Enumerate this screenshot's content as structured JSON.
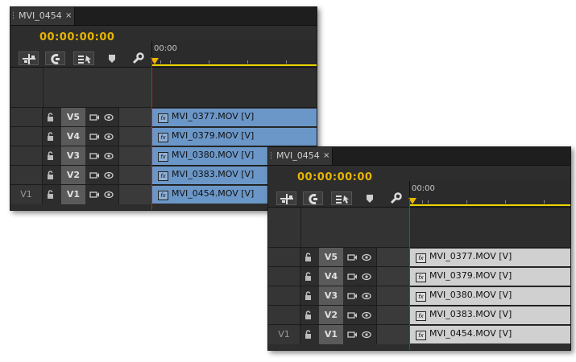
{
  "panels": [
    {
      "id": "a",
      "tab_title": "MVI_0454",
      "tab_close": "×",
      "timecode": "00:00:00:00",
      "ruler_start": "00:00",
      "clip_color": "#6b97c8",
      "source_patch": "V1",
      "tracks": [
        {
          "name": "V5",
          "clip": "MVI_0377.MOV [V]"
        },
        {
          "name": "V4",
          "clip": "MVI_0379.MOV [V]"
        },
        {
          "name": "V3",
          "clip": "MVI_0380.MOV [V]"
        },
        {
          "name": "V2",
          "clip": "MVI_0383.MOV [V]"
        },
        {
          "name": "V1",
          "clip": "MVI_0454.MOV [V]"
        }
      ]
    },
    {
      "id": "b",
      "tab_title": "MVI_0454",
      "tab_close": "×",
      "timecode": "00:00:00:00",
      "ruler_start": "00:00",
      "clip_color": "#d0d0d0",
      "source_patch": "V1",
      "tracks": [
        {
          "name": "V5",
          "clip": "MVI_0377.MOV [V]"
        },
        {
          "name": "V4",
          "clip": "MVI_0379.MOV [V]"
        },
        {
          "name": "V3",
          "clip": "MVI_0380.MOV [V]"
        },
        {
          "name": "V2",
          "clip": "MVI_0383.MOV [V]"
        },
        {
          "name": "V1",
          "clip": "MVI_0454.MOV [V]"
        }
      ]
    }
  ],
  "icons": {
    "fx_badge": "fx",
    "toolbar": [
      "snap-icon",
      "linked-selection-icon",
      "add-marker-icon",
      "marker-icon",
      "wrench-icon"
    ],
    "track": [
      "lock-icon",
      "toggle-output-icon",
      "eye-icon"
    ]
  },
  "colors": {
    "timecode": "#e8b500",
    "playhead": "#c81d1d",
    "work_area": "#e8d400"
  }
}
